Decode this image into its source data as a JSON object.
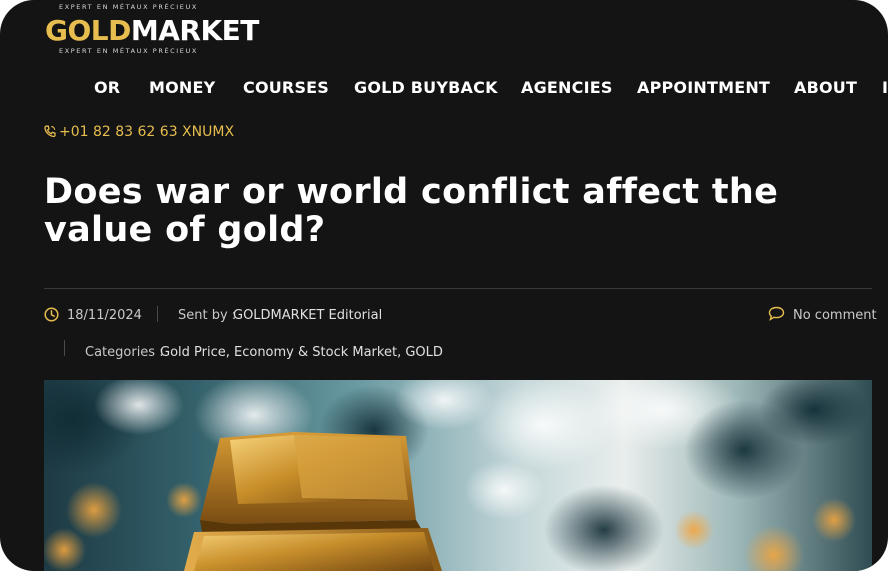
{
  "logo": {
    "tagline_top": "EXPERT EN MÉTAUX PRÉCIEUX",
    "word_gold": "GOLD",
    "word_market": "MARKET",
    "tagline_bottom": "EXPERT EN MÉTAUX PRÉCIEUX"
  },
  "nav": {
    "items": [
      "OR",
      "MONEY",
      "COURSES",
      "GOLD BUYBACK",
      "AGENCIES",
      "APPOINTMENT",
      "ABOUT",
      "I"
    ]
  },
  "contact": {
    "phone": "+01 82 83 62 63 XNUMX",
    "icon": "phone-icon"
  },
  "article": {
    "title": "Does war or world conflict affect the value of gold?",
    "date": "18/11/2024",
    "sent_by_label": "Sent by :",
    "author": "GOLDMARKET Editorial",
    "comments": "No comment",
    "categories_label": "Categories :",
    "categories": "Gold Price, Economy & Stock Market, GOLD"
  },
  "colors": {
    "background": "#141414",
    "accent": "#e6bd4e",
    "text": "#ffffff"
  }
}
